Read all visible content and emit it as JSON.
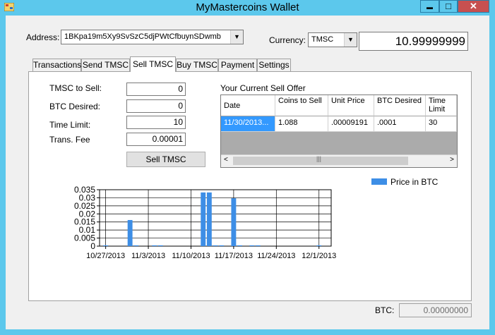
{
  "window": {
    "title": "MyMastercoins Wallet",
    "min_glyph": "▬",
    "max_glyph": "□",
    "close_glyph": "✕"
  },
  "header": {
    "address_label": "Address:",
    "address_value": "1BKpa19m5Xy9SvSzC5djPWtCfbuynSDwmb",
    "currency_label": "Currency:",
    "currency_value": "TMSC",
    "balance": "10.99999999"
  },
  "tabs": [
    {
      "label": "Transactions"
    },
    {
      "label": "Send TMSC"
    },
    {
      "label": "Sell TMSC",
      "active": true
    },
    {
      "label": "Buy TMSC"
    },
    {
      "label": "Payment"
    },
    {
      "label": "Settings"
    }
  ],
  "sell_form": {
    "tmsc_label": "TMSC to Sell:",
    "tmsc_value": "0",
    "btc_label": "BTC Desired:",
    "btc_value": "0",
    "time_label": "Time Limit:",
    "time_value": "10",
    "fee_label": "Trans. Fee",
    "fee_value": "0.00001",
    "sell_button": "Sell TMSC"
  },
  "sell_offer": {
    "title": "Your Current Sell Offer",
    "headers": [
      "Date",
      "Coins to Sell",
      "Unit Price",
      "BTC Desired",
      "Time Limit"
    ],
    "rows": [
      [
        "11/30/2013...",
        "1.088",
        ".00009191",
        ".0001",
        "30"
      ]
    ]
  },
  "footer": {
    "btc_label": "BTC:",
    "btc_value": "0.00000000"
  },
  "chart_data": {
    "type": "bar",
    "legend": [
      "Price in BTC"
    ],
    "legend_position": "top-right",
    "color": "#3d8ee6",
    "ylim": [
      0,
      0.035
    ],
    "yticks": [
      "0",
      "0.005",
      "0.01",
      "0.015",
      "0.02",
      "0.025",
      "0.03",
      "0.035"
    ],
    "xticks": [
      "10/27/2013",
      "11/3/2013",
      "11/10/2013",
      "11/17/2013",
      "11/24/2013",
      "12/1/2013"
    ],
    "xlim_days": [
      -1,
      37
    ],
    "grid": true,
    "bars": [
      {
        "day": 0,
        "value": 0.0005
      },
      {
        "day": 4,
        "value": 0.0162
      },
      {
        "day": 5,
        "value": 0.0005
      },
      {
        "day": 8,
        "value": 0.0005
      },
      {
        "day": 9,
        "value": 0.0005
      },
      {
        "day": 16,
        "value": 0.0333
      },
      {
        "day": 17,
        "value": 0.0333
      },
      {
        "day": 18,
        "value": 0.0005
      },
      {
        "day": 19,
        "value": 0.0005
      },
      {
        "day": 21,
        "value": 0.0297
      },
      {
        "day": 22,
        "value": 0.0005
      },
      {
        "day": 24,
        "value": 0.0005
      },
      {
        "day": 25,
        "value": 0.0005
      },
      {
        "day": 35,
        "value": 0.0005
      }
    ]
  }
}
